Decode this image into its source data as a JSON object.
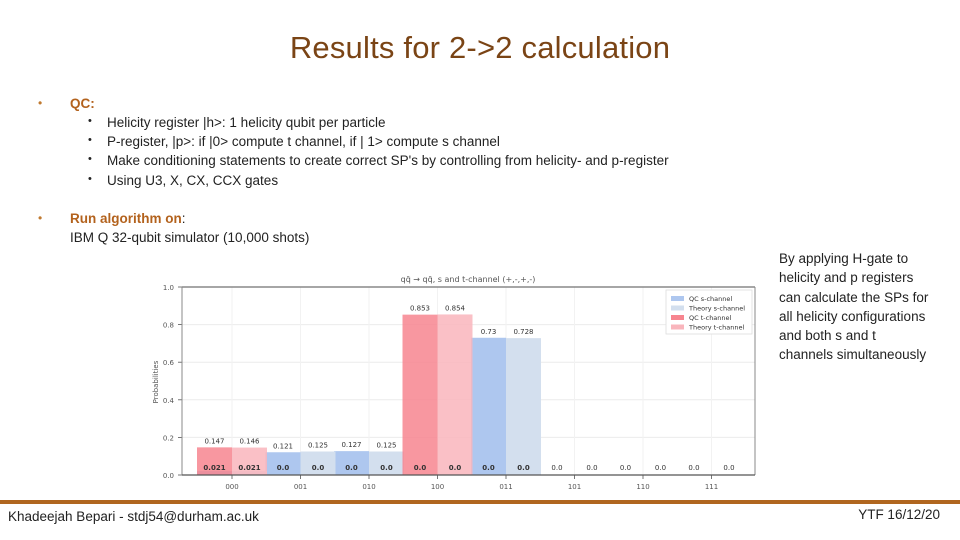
{
  "slide": {
    "title": "Results for 2->2 calculation",
    "bullets": {
      "qc_label": "QC:",
      "qc_items": [
        "Helicity register |h>: 1 helicity qubit per particle",
        "P-register, |p>: if |0> compute  t channel, if | 1> compute  s channel",
        "Make conditioning statements to create correct SP's by controlling from helicity- and p-register",
        "Using U3, X, CX, CCX gates"
      ],
      "run_label": "Run algorithm on",
      "run_colon": ":",
      "run_detail": "IBM Q 32-qubit simulator (10,000 shots)"
    },
    "side_note": "By applying H-gate to helicity and p registers can calculate the SPs for all helicity configurations and both s and t channels simultaneously",
    "footer": {
      "author": "Khadeejah Bepari - stdj54@durham.ac.uk",
      "event_date": "YTF 16/12/20"
    },
    "colors": {
      "title": "#7a4415",
      "accent": "#b3621d",
      "footer_rule": "#b0661f"
    }
  },
  "chart_data": {
    "type": "bar",
    "title": "qq̄ → qq̄, s and t-channel (+,-,+,-)",
    "xlabel": "",
    "ylabel": "Probabilities",
    "ylim": [
      0,
      1.0
    ],
    "yticks": [
      "0.0",
      "0.2",
      "0.4",
      "0.6",
      "0.8",
      "1.0"
    ],
    "ytick_values": [
      0,
      0.2,
      0.4,
      0.6,
      0.8,
      1.0
    ],
    "grid": true,
    "legend_position": "top-right",
    "categories": [
      "000",
      "001",
      "010",
      "100",
      "011",
      "101",
      "110",
      "111"
    ],
    "series": [
      {
        "name": "QC s-channel",
        "color": "#aec7ef",
        "slot": "left",
        "values": [
          0.021,
          0.121,
          0.127,
          0.0,
          0.73,
          0.0,
          0.0,
          0.0
        ],
        "labels": [
          "0.021",
          "0.121",
          "0.127",
          "0.0",
          "0.73",
          "0.0",
          "0.0",
          "0.0"
        ]
      },
      {
        "name": "Theory s-channel",
        "color": "#d3dfee",
        "slot": "right",
        "values": [
          0.021,
          0.125,
          0.125,
          0.0,
          0.728,
          0.0,
          0.0,
          0.0
        ],
        "labels": [
          "0.021",
          "0.125",
          "0.125",
          "0.0",
          "0.728",
          "0.0",
          "0.0",
          "0.0"
        ]
      },
      {
        "name": "QC t-channel",
        "color": "#f7858f",
        "slot": "left",
        "values": [
          0.147,
          0.0,
          0.0,
          0.853,
          0.0,
          0.0,
          0.0,
          0.0
        ],
        "labels": [
          "0.147",
          "0.0",
          "0.0",
          "0.853",
          "0.0",
          "0.0",
          "0.0",
          "0.0"
        ]
      },
      {
        "name": "Theory t-channel",
        "color": "#f9b5bc",
        "slot": "right",
        "values": [
          0.146,
          0.0,
          0.0,
          0.854,
          0.0,
          0.0,
          0.0,
          0.0
        ],
        "labels": [
          "0.146",
          "0.0",
          "0.0",
          "0.854",
          "0.0",
          "0.0",
          "0.0",
          "0.0"
        ]
      }
    ]
  }
}
